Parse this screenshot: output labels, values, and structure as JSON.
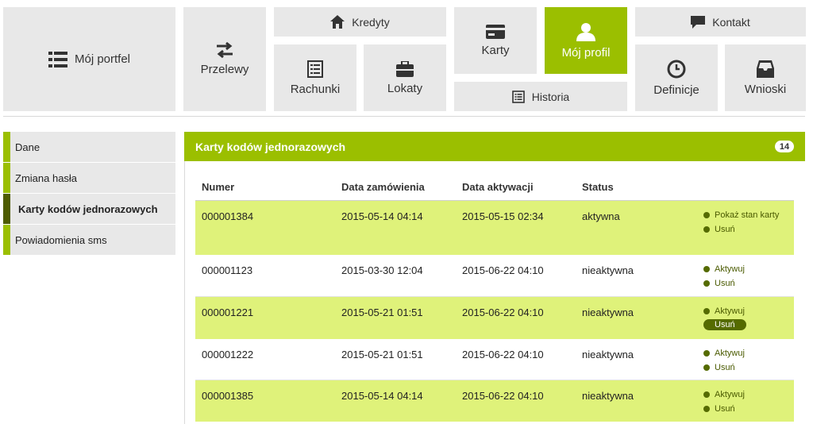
{
  "nav": {
    "tiles": {
      "portfel": "Mój portfel",
      "przelewy": "Przelewy",
      "kredyty": "Kredyty",
      "rachunki": "Rachunki",
      "lokaty": "Lokaty",
      "karty": "Karty",
      "profil": "Mój profil",
      "historia": "Historia",
      "kontakt": "Kontakt",
      "definicje": "Definicje",
      "wnioski": "Wnioski"
    },
    "active": "Mój profil"
  },
  "sidebar": {
    "items": [
      {
        "label": "Dane"
      },
      {
        "label": "Zmiana hasła"
      },
      {
        "label": "Karty kodów jednorazowych"
      },
      {
        "label": "Powiadomienia sms"
      }
    ],
    "active_index": 2
  },
  "panel": {
    "title": "Karty kodów jednorazowych",
    "count": "14",
    "columns": [
      "Numer",
      "Data zamówienia",
      "Data aktywacji",
      "Status"
    ],
    "rows": [
      {
        "numer": "000001384",
        "order": "2015-05-14 04:14",
        "activation": "2015-05-15 02:34",
        "status": "aktywna",
        "actions": [
          "Pokaż stan karty",
          "Usuń"
        ]
      },
      {
        "numer": "000001123",
        "order": "2015-03-30 12:04",
        "activation": "2015-06-22 04:10",
        "status": "nieaktywna",
        "actions": [
          "Aktywuj",
          "Usuń"
        ]
      },
      {
        "numer": "000001221",
        "order": "2015-05-21 01:51",
        "activation": "2015-06-22 04:10",
        "status": "nieaktywna",
        "actions": [
          "Aktywuj",
          "Usuń"
        ]
      },
      {
        "numer": "000001222",
        "order": "2015-05-21 01:51",
        "activation": "2015-06-22 04:10",
        "status": "nieaktywna",
        "actions": [
          "Aktywuj",
          "Usuń"
        ]
      },
      {
        "numer": "000001385",
        "order": "2015-05-14 04:14",
        "activation": "2015-06-22 04:10",
        "status": "nieaktywna",
        "actions": [
          "Aktywuj",
          "Usuń"
        ]
      }
    ]
  },
  "colors": {
    "accent": "#9bbf00",
    "accent_dark": "#556b00",
    "row_highlight": "#dff27a",
    "tile_bg": "#e8e8e8"
  },
  "icons": [
    "list-icon",
    "transfer-icon",
    "home-icon",
    "ledger-icon",
    "briefcase-icon",
    "card-icon",
    "user-icon",
    "history-icon",
    "chat-icon",
    "clock-icon",
    "inbox-icon"
  ]
}
